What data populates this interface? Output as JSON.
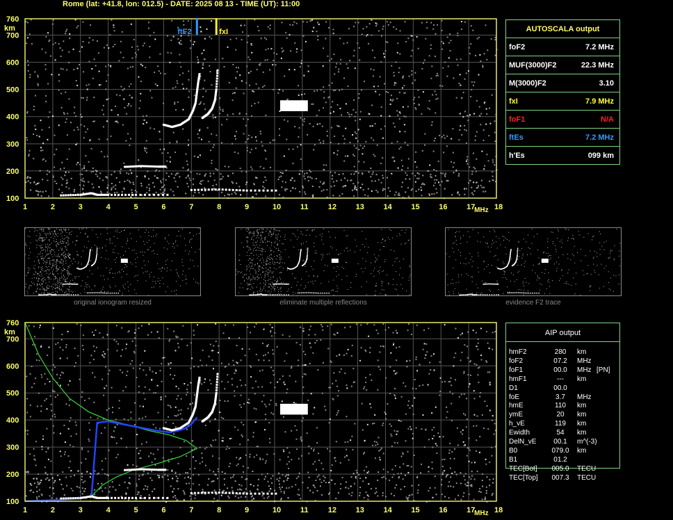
{
  "header": {
    "title": "Rome (lat: +41.8, lon: 012.5) - DATE: 2025 08 13 - TIME (UT): 11:00"
  },
  "axis": {
    "y_ticks": [
      "760",
      "700",
      "600",
      "500",
      "400",
      "300",
      "200",
      "100"
    ],
    "y_unit": "km",
    "x_ticks": [
      "1",
      "2",
      "3",
      "4",
      "5",
      "6",
      "7",
      "8",
      "9",
      "10",
      "11",
      "12",
      "13",
      "14",
      "15",
      "16",
      "17",
      "18"
    ],
    "x_unit": "MHz"
  },
  "markers": {
    "ftf2_label": "ftF2",
    "fxi_label": "fxI"
  },
  "autoscala": {
    "title": "AUTOSCALA output",
    "rows": [
      {
        "name": "foF2",
        "value": "7.2 MHz",
        "color": "#ffffff"
      },
      {
        "name": "MUF(3000)F2",
        "value": "22.3 MHz",
        "color": "#ffffff"
      },
      {
        "name": "M(3000)F2",
        "value": "3.10",
        "color": "#ffffff"
      },
      {
        "name": "fxI",
        "value": "7.9 MHz",
        "color": "#ffff33"
      },
      {
        "name": "foF1",
        "value": "N/A",
        "color": "#ff2020"
      },
      {
        "name": "ftEs",
        "value": "7.2 MHz",
        "color": "#3399ff"
      },
      {
        "name": "h'Es",
        "value": "099    km",
        "color": "#ffffff"
      }
    ]
  },
  "thumbnails": [
    {
      "caption": "original ionogram resized"
    },
    {
      "caption": "eliminate multiple reflections"
    },
    {
      "caption": "evidence F2 trace"
    }
  ],
  "aip": {
    "title": "AIP output",
    "rows": [
      [
        "hmF2",
        "280",
        "km",
        ""
      ],
      [
        "foF2",
        "07.2",
        "MHz",
        ""
      ],
      [
        "foF1",
        "00.0",
        "MHz",
        "[PN]"
      ],
      [
        "hmF1",
        "---",
        "km",
        ""
      ],
      [
        "D1",
        "00.0",
        "",
        ""
      ],
      [
        "foE",
        "3.7",
        "MHz",
        ""
      ],
      [
        "hmE",
        "110",
        "km",
        ""
      ],
      [
        "ymE",
        "20",
        "km",
        ""
      ],
      [
        "h_vE",
        "119",
        "km",
        ""
      ],
      [
        "Ewidth",
        "54",
        "km",
        ""
      ],
      [
        "DelN_vE",
        "00.1",
        "m^(-3)",
        ""
      ],
      [
        "B0",
        "079.0",
        "km",
        ""
      ],
      [
        "B1",
        "01.2",
        "",
        ""
      ],
      [
        "TEC[Bot]",
        "005.0",
        "TECU",
        ""
      ],
      [
        "TEC[Top]",
        "007.3",
        "TECU",
        ""
      ]
    ]
  },
  "chart_data": [
    {
      "type": "scatter",
      "title": "",
      "xlabel": "MHz",
      "ylabel": "km",
      "xlim": [
        1,
        18
      ],
      "ylim": [
        100,
        760
      ],
      "grid": true,
      "series": [
        {
          "name": "",
          "color": "#ffffff",
          "x": [
            6.0,
            6.3,
            6.6,
            6.9,
            7.05,
            7.15,
            7.2,
            7.25,
            7.3
          ],
          "y": [
            370,
            362,
            370,
            390,
            420,
            450,
            490,
            530,
            560
          ]
        },
        {
          "name": "",
          "color": "#ffffff",
          "x": [
            7.4,
            7.6,
            7.75,
            7.85,
            7.9,
            7.95
          ],
          "y": [
            395,
            410,
            430,
            460,
            500,
            580
          ]
        },
        {
          "name": "",
          "color": "#ffffff",
          "x": [
            2.3,
            3.0,
            3.4,
            3.6,
            4.0,
            5.0,
            6.3
          ],
          "y": [
            110,
            112,
            118,
            112,
            112,
            112,
            112
          ]
        },
        {
          "name": "",
          "color": "#ffffff",
          "x": [
            7.0,
            8.0,
            9.0,
            10.2
          ],
          "y": [
            130,
            132,
            128,
            128
          ]
        },
        {
          "name": "",
          "color": "#ffffff",
          "x": [
            4.6,
            5.2,
            5.8,
            6.1
          ],
          "y": [
            215,
            218,
            216,
            216
          ]
        }
      ],
      "annotations": {
        "ftf2_mhz": 7.2,
        "fxi_mhz": 7.9
      }
    },
    {
      "type": "line",
      "title": "",
      "xlabel": "MHz",
      "ylabel": "km",
      "xlim": [
        1,
        18
      ],
      "ylim": [
        100,
        760
      ],
      "grid": true,
      "series": [
        {
          "name": "",
          "color": "#33cc33",
          "x": [
            1.0,
            1.5,
            2.0,
            2.6,
            3.3,
            4.0,
            4.8,
            5.5,
            6.2,
            6.8,
            7.2,
            6.6,
            5.8,
            4.9,
            4.3,
            3.8,
            3.5,
            3.35
          ],
          "y": [
            760,
            640,
            555,
            480,
            430,
            400,
            380,
            360,
            345,
            325,
            295,
            265,
            240,
            215,
            190,
            160,
            130,
            110
          ]
        },
        {
          "name": "",
          "color": "#2244ff",
          "x": [
            1.0,
            2.0,
            3.0,
            3.4,
            3.6,
            4.0,
            5.0,
            5.8,
            6.2,
            6.5,
            6.8,
            7.0,
            7.2
          ],
          "y": [
            100,
            104,
            110,
            120,
            390,
            395,
            375,
            360,
            355,
            360,
            370,
            385,
            410
          ]
        }
      ]
    }
  ]
}
